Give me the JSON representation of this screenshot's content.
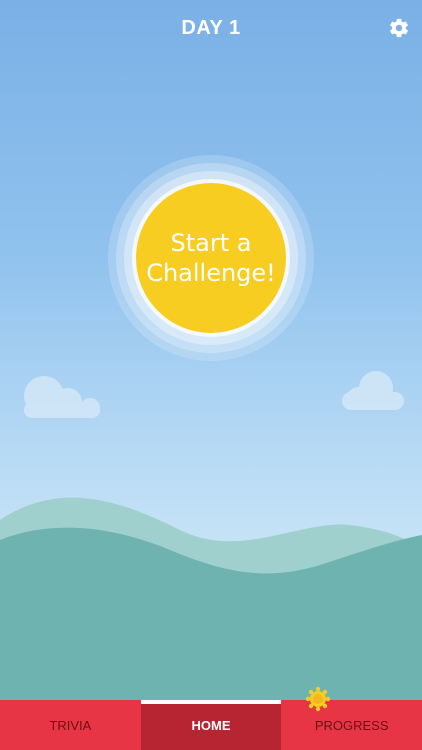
{
  "header": {
    "title": "DAY 1",
    "settings_icon": "gear-icon"
  },
  "main": {
    "start_button_label": "Start a Challenge!"
  },
  "tabbar": {
    "tabs": [
      {
        "label": "TRIVIA",
        "active": false
      },
      {
        "label": "HOME",
        "active": true
      },
      {
        "label": "PROGRESS",
        "active": false,
        "badge_icon": "sun-badge-icon"
      }
    ]
  },
  "colors": {
    "sky_top": "#7ab0e6",
    "sun": "#f8cd22",
    "tabbar": "#e83545",
    "tab_active": "#b82532",
    "hill_front": "#6fb3b1",
    "hill_back": "#9fd0cd"
  }
}
